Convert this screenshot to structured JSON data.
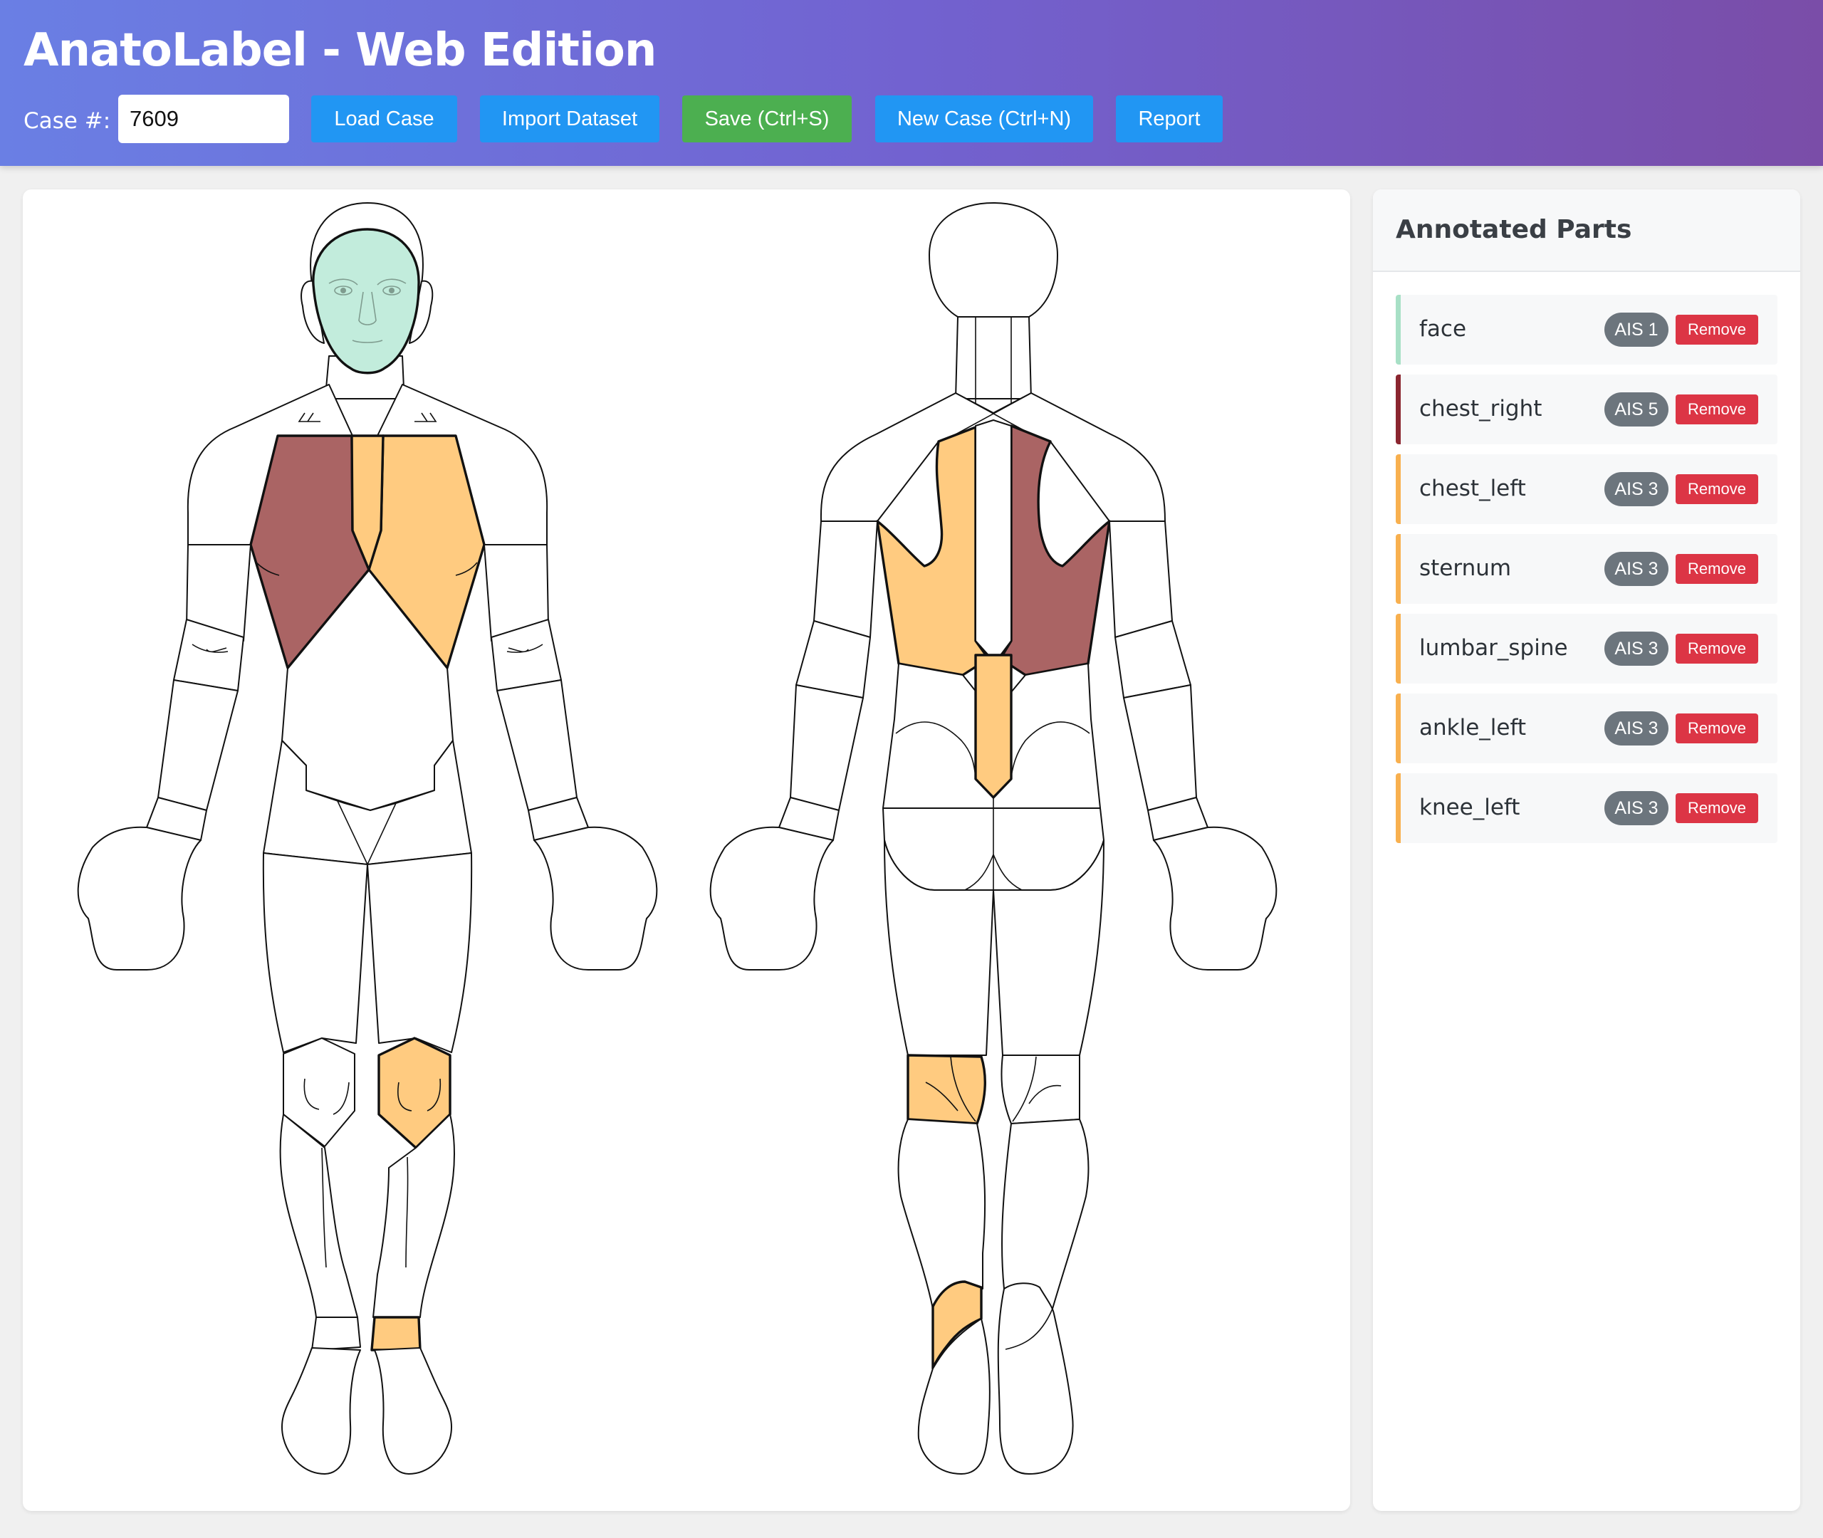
{
  "app": {
    "title": "AnatoLabel - Web Edition",
    "case_label": "Case #:",
    "case_value": "7609"
  },
  "toolbar": {
    "load_case": "Load Case",
    "import_dataset": "Import Dataset",
    "save": "Save (Ctrl+S)",
    "new_case": "New Case (Ctrl+N)",
    "report": "Report"
  },
  "panel": {
    "title": "Annotated Parts",
    "remove_label": "Remove",
    "items": [
      {
        "name": "face",
        "ais": "AIS 1",
        "color": "#a8e0c6"
      },
      {
        "name": "chest_right",
        "ais": "AIS 5",
        "color": "#8b2630"
      },
      {
        "name": "chest_left",
        "ais": "AIS 3",
        "color": "#f8b04f"
      },
      {
        "name": "sternum",
        "ais": "AIS 3",
        "color": "#f8b04f"
      },
      {
        "name": "lumbar_spine",
        "ais": "AIS 3",
        "color": "#f8b04f"
      },
      {
        "name": "ankle_left",
        "ais": "AIS 3",
        "color": "#f8b04f"
      },
      {
        "name": "knee_left",
        "ais": "AIS 3",
        "color": "#f8b04f"
      }
    ]
  },
  "severity_fills": {
    "ais1": "#c2ecdc",
    "ais3": "#ffcb80",
    "ais5": "#aa6464"
  }
}
